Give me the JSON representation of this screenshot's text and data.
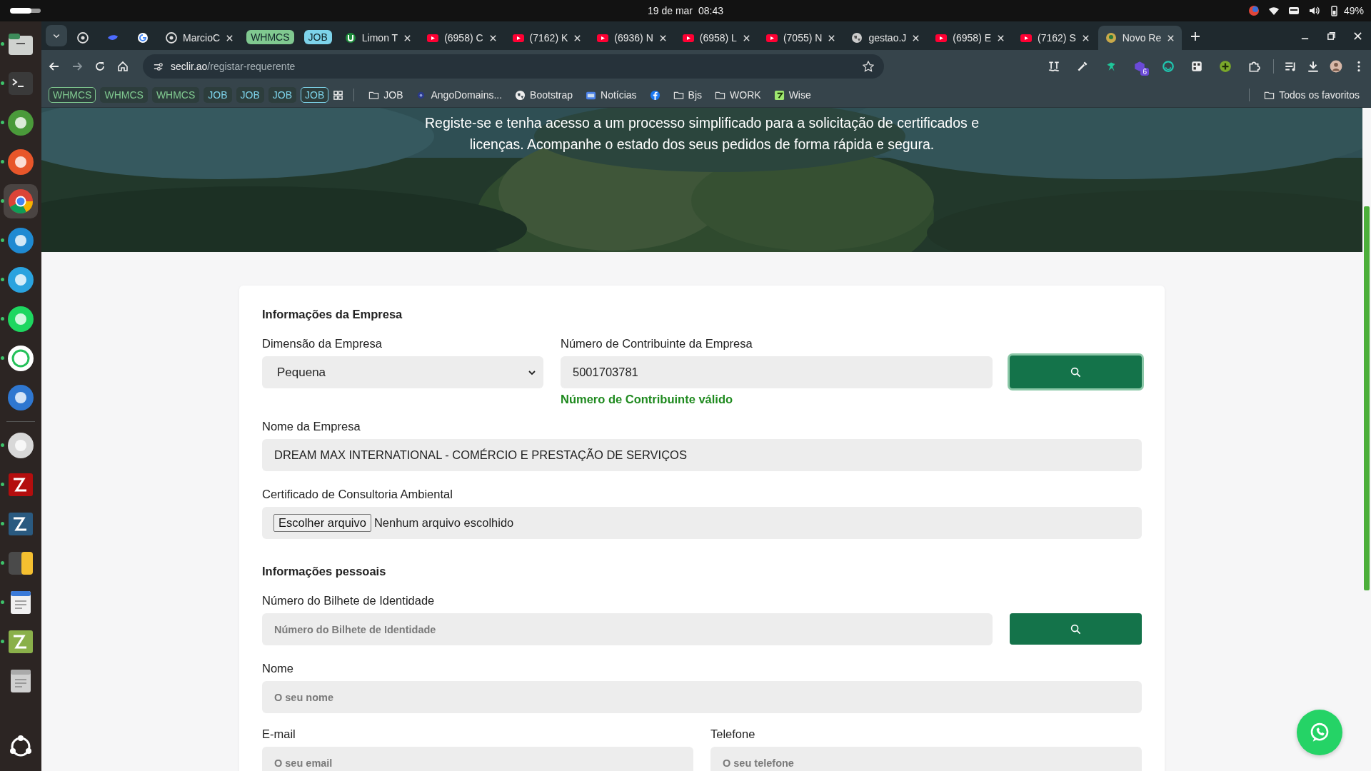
{
  "system_bar": {
    "date": "19 de mar",
    "time": "08:43",
    "battery": "49%"
  },
  "dock": [
    {
      "kind": "files",
      "running": true,
      "selected": false
    },
    {
      "kind": "terminal",
      "running": true,
      "selected": false
    },
    {
      "kind": "keepass",
      "running": true,
      "selected": false
    },
    {
      "kind": "firefox",
      "running": true,
      "selected": false
    },
    {
      "kind": "chrome",
      "running": true,
      "selected": true
    },
    {
      "kind": "vscode",
      "running": true,
      "selected": false
    },
    {
      "kind": "telegram",
      "running": true,
      "selected": false
    },
    {
      "kind": "spotify",
      "running": true,
      "selected": false
    },
    {
      "kind": "whatsapp",
      "running": true,
      "selected": false
    },
    {
      "kind": "thunderbird",
      "running": false,
      "selected": false
    },
    {
      "kind": "settings",
      "running": true,
      "selected": false
    },
    {
      "kind": "filezilla",
      "running": true,
      "selected": false
    },
    {
      "kind": "workbench",
      "running": true,
      "selected": false
    },
    {
      "kind": "calculator",
      "running": true,
      "selected": false
    },
    {
      "kind": "editor",
      "running": true,
      "selected": false
    },
    {
      "kind": "paint",
      "running": true,
      "selected": false
    },
    {
      "kind": "trash",
      "running": false,
      "selected": false
    },
    {
      "kind": "apps",
      "running": false,
      "selected": false
    }
  ],
  "tabs": [
    {
      "kind": "pinned",
      "selected": false
    },
    {
      "kind": "pinned",
      "selected": false
    },
    {
      "kind": "pinned",
      "selected": false
    },
    {
      "kind": "tab",
      "label": "MarcioC",
      "selected": false
    },
    {
      "kind": "group",
      "label": "WHMCS",
      "color": "#80c990"
    },
    {
      "kind": "group",
      "label": "JOB",
      "color": "#7dd3ea"
    },
    {
      "kind": "tab",
      "label": "Limon T",
      "selected": false
    },
    {
      "kind": "tab",
      "label": "(6958) C",
      "selected": false
    },
    {
      "kind": "tab",
      "label": "(7162) K",
      "selected": false
    },
    {
      "kind": "tab",
      "label": "(6936) N",
      "selected": false
    },
    {
      "kind": "tab",
      "label": "(6958) L",
      "selected": false
    },
    {
      "kind": "tab",
      "label": "(7055) N",
      "selected": false
    },
    {
      "kind": "tab",
      "label": "gestao.J",
      "selected": false
    },
    {
      "kind": "tab",
      "label": "(6958) E",
      "selected": false
    },
    {
      "kind": "tab",
      "label": "(7162) S",
      "selected": false
    },
    {
      "kind": "tab",
      "label": "Novo Re",
      "selected": true
    }
  ],
  "address": {
    "host": "seclir.ao",
    "path": "/registar-requerente"
  },
  "extensions": [
    {
      "kind": "translate"
    },
    {
      "kind": "eyedropper"
    },
    {
      "kind": "runner"
    },
    {
      "kind": "cube",
      "badge": "6"
    },
    {
      "kind": "smile"
    },
    {
      "kind": "qr"
    },
    {
      "kind": "plus"
    },
    {
      "kind": "puzzle"
    }
  ],
  "bookmarks": [
    {
      "kind": "group",
      "label": "WHMCS",
      "color": "#80c990",
      "open": true
    },
    {
      "kind": "group",
      "label": "WHMCS",
      "color": "#80c990",
      "open": false
    },
    {
      "kind": "group",
      "label": "WHMCS",
      "color": "#80c990",
      "open": false
    },
    {
      "kind": "group",
      "label": "JOB",
      "color": "#7dd3ea",
      "open": false
    },
    {
      "kind": "group",
      "label": "JOB",
      "color": "#7dd3ea",
      "open": false
    },
    {
      "kind": "group",
      "label": "JOB",
      "color": "#7dd3ea",
      "open": false
    },
    {
      "kind": "group",
      "label": "JOB",
      "color": "#7dd3ea",
      "open": true
    },
    {
      "kind": "apps"
    },
    {
      "kind": "folder",
      "label": "JOB"
    },
    {
      "kind": "domains",
      "label": "AngoDomains..."
    },
    {
      "kind": "globe",
      "label": "Bootstrap"
    },
    {
      "kind": "news",
      "label": "Notícias"
    },
    {
      "kind": "facebook"
    },
    {
      "kind": "folder",
      "label": "Bjs"
    },
    {
      "kind": "folder",
      "label": "WORK"
    },
    {
      "kind": "wise",
      "label": "Wise"
    }
  ],
  "all_bookmarks": "Todos os favoritos",
  "hero": {
    "text": "Registe-se e tenha acesso a um processo simplificado para a solicitação de certificados e licenças. Acompanhe o estado dos seus pedidos de forma rápida e segura."
  },
  "company": {
    "title": "Informações da Empresa",
    "size": {
      "label": "Dimensão da Empresa",
      "value": "Pequena"
    },
    "tax_id": {
      "label": "Número de Contribuinte da Empresa",
      "value": "5001703781",
      "message": "Número de Contribuinte válido",
      "search_focused": true
    },
    "name": {
      "label": "Nome da Empresa",
      "value": "DREAM MAX INTERNATIONAL - COMÉRCIO E PRESTAÇÃO DE SERVIÇOS"
    },
    "certificate": {
      "label": "Certificado de Consultoria Ambiental",
      "button": "Escolher arquivo",
      "status": "Nenhum arquivo escolhido"
    }
  },
  "personal": {
    "title": "Informações pessoais",
    "id_number": {
      "label": "Número do Bilhete de Identidade",
      "placeholder": "Número do Bilhete de Identidade",
      "search_focused": false
    },
    "name": {
      "label": "Nome",
      "placeholder": "O seu nome"
    },
    "email": {
      "label": "E-mail",
      "placeholder": "O seu email"
    },
    "phone": {
      "label": "Telefone",
      "placeholder": "O seu telefone"
    }
  }
}
